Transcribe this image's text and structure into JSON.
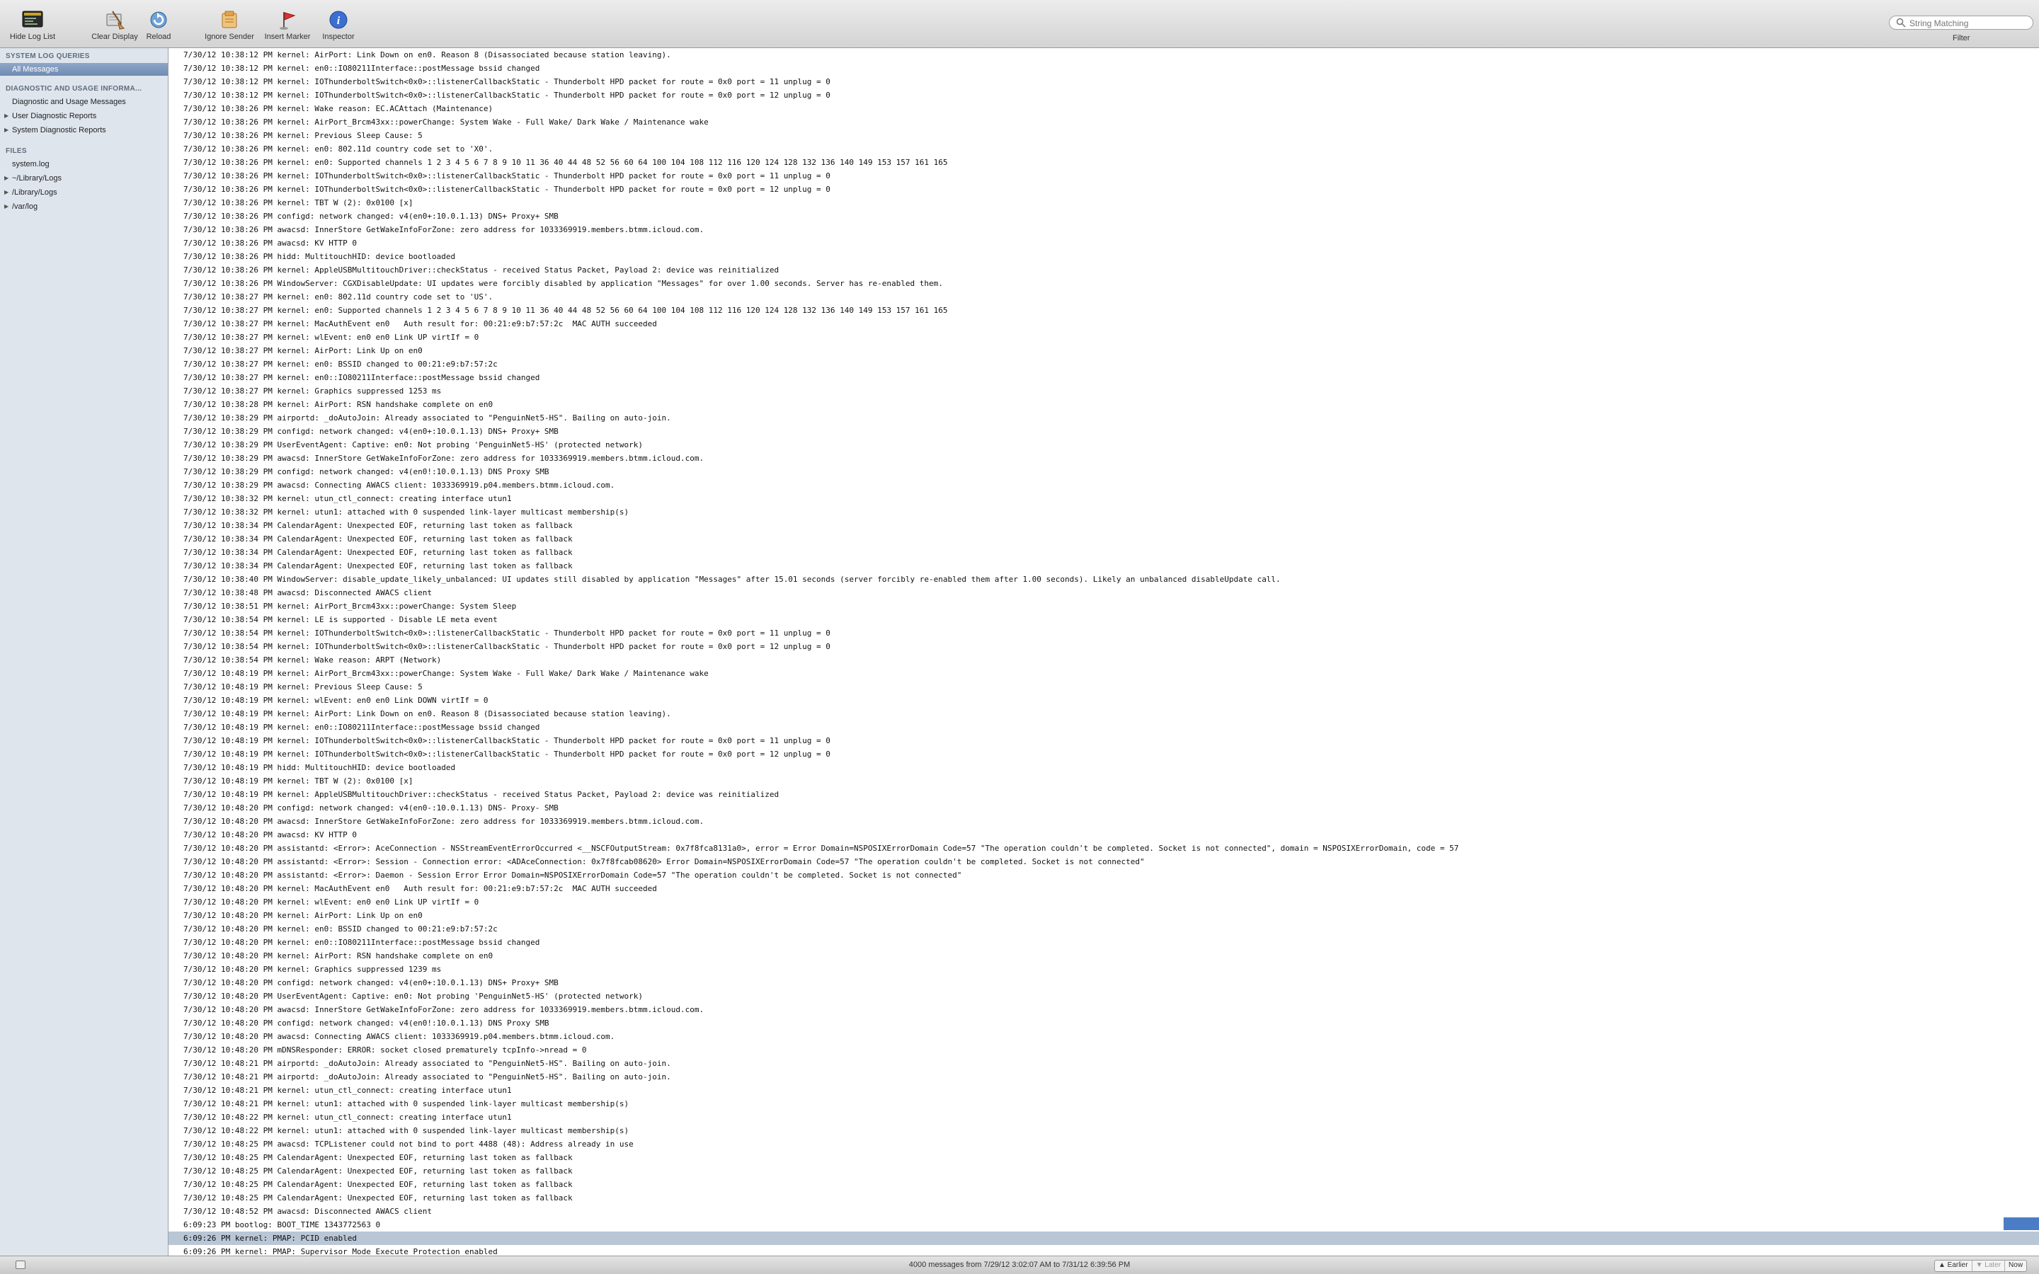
{
  "toolbar": {
    "hide_log_list": "Hide Log List",
    "clear_display": "Clear Display",
    "reload": "Reload",
    "ignore_sender": "Ignore Sender",
    "insert_marker": "Insert Marker",
    "inspector": "Inspector",
    "search_placeholder": "String Matching",
    "filter": "Filter"
  },
  "sidebar": {
    "section_system_log_queries": "SYSTEM LOG QUERIES",
    "all_messages": "All Messages",
    "section_diagnostic": "DIAGNOSTIC AND USAGE INFORMA...",
    "diag_usage_messages": "Diagnostic and Usage Messages",
    "user_diag_reports": "User Diagnostic Reports",
    "system_diag_reports": "System Diagnostic Reports",
    "section_files": "FILES",
    "system_log": "system.log",
    "user_library_logs": "~/Library/Logs",
    "library_logs": "/Library/Logs",
    "var_log": "/var/log"
  },
  "log_lines": [
    "7/30/12 10:38:12 PM kernel: AirPort: Link Down on en0. Reason 8 (Disassociated because station leaving).",
    "7/30/12 10:38:12 PM kernel: en0::IO80211Interface::postMessage bssid changed",
    "7/30/12 10:38:12 PM kernel: IOThunderboltSwitch<0x0>::listenerCallbackStatic - Thunderbolt HPD packet for route = 0x0 port = 11 unplug = 0",
    "7/30/12 10:38:12 PM kernel: IOThunderboltSwitch<0x0>::listenerCallbackStatic - Thunderbolt HPD packet for route = 0x0 port = 12 unplug = 0",
    "7/30/12 10:38:26 PM kernel: Wake reason: EC.ACAttach (Maintenance)",
    "7/30/12 10:38:26 PM kernel: AirPort_Brcm43xx::powerChange: System Wake - Full Wake/ Dark Wake / Maintenance wake",
    "7/30/12 10:38:26 PM kernel: Previous Sleep Cause: 5",
    "7/30/12 10:38:26 PM kernel: en0: 802.11d country code set to 'X0'.",
    "7/30/12 10:38:26 PM kernel: en0: Supported channels 1 2 3 4 5 6 7 8 9 10 11 36 40 44 48 52 56 60 64 100 104 108 112 116 120 124 128 132 136 140 149 153 157 161 165",
    "7/30/12 10:38:26 PM kernel: IOThunderboltSwitch<0x0>::listenerCallbackStatic - Thunderbolt HPD packet for route = 0x0 port = 11 unplug = 0",
    "7/30/12 10:38:26 PM kernel: IOThunderboltSwitch<0x0>::listenerCallbackStatic - Thunderbolt HPD packet for route = 0x0 port = 12 unplug = 0",
    "7/30/12 10:38:26 PM kernel: TBT W (2): 0x0100 [x]",
    "7/30/12 10:38:26 PM configd: network changed: v4(en0+:10.0.1.13) DNS+ Proxy+ SMB",
    "7/30/12 10:38:26 PM awacsd: InnerStore GetWakeInfoForZone: zero address for 1033369919.members.btmm.icloud.com.",
    "7/30/12 10:38:26 PM awacsd: KV HTTP 0",
    "7/30/12 10:38:26 PM hidd: MultitouchHID: device bootloaded",
    "7/30/12 10:38:26 PM kernel: AppleUSBMultitouchDriver::checkStatus - received Status Packet, Payload 2: device was reinitialized",
    "7/30/12 10:38:26 PM WindowServer: CGXDisableUpdate: UI updates were forcibly disabled by application \"Messages\" for over 1.00 seconds. Server has re-enabled them.",
    "7/30/12 10:38:27 PM kernel: en0: 802.11d country code set to 'US'.",
    "7/30/12 10:38:27 PM kernel: en0: Supported channels 1 2 3 4 5 6 7 8 9 10 11 36 40 44 48 52 56 60 64 100 104 108 112 116 120 124 128 132 136 140 149 153 157 161 165",
    "7/30/12 10:38:27 PM kernel: MacAuthEvent en0   Auth result for: 00:21:e9:b7:57:2c  MAC AUTH succeeded",
    "7/30/12 10:38:27 PM kernel: wlEvent: en0 en0 Link UP virtIf = 0",
    "7/30/12 10:38:27 PM kernel: AirPort: Link Up on en0",
    "7/30/12 10:38:27 PM kernel: en0: BSSID changed to 00:21:e9:b7:57:2c",
    "7/30/12 10:38:27 PM kernel: en0::IO80211Interface::postMessage bssid changed",
    "7/30/12 10:38:27 PM kernel: Graphics suppressed 1253 ms",
    "7/30/12 10:38:28 PM kernel: AirPort: RSN handshake complete on en0",
    "7/30/12 10:38:29 PM airportd: _doAutoJoin: Already associated to \"PenguinNet5-HS\". Bailing on auto-join.",
    "7/30/12 10:38:29 PM configd: network changed: v4(en0+:10.0.1.13) DNS+ Proxy+ SMB",
    "7/30/12 10:38:29 PM UserEventAgent: Captive: en0: Not probing 'PenguinNet5-HS' (protected network)",
    "7/30/12 10:38:29 PM awacsd: InnerStore GetWakeInfoForZone: zero address for 1033369919.members.btmm.icloud.com.",
    "7/30/12 10:38:29 PM configd: network changed: v4(en0!:10.0.1.13) DNS Proxy SMB",
    "7/30/12 10:38:29 PM awacsd: Connecting AWACS client: 1033369919.p04.members.btmm.icloud.com.",
    "7/30/12 10:38:32 PM kernel: utun_ctl_connect: creating interface utun1",
    "7/30/12 10:38:32 PM kernel: utun1: attached with 0 suspended link-layer multicast membership(s)",
    "7/30/12 10:38:34 PM CalendarAgent: Unexpected EOF, returning last token as fallback",
    "7/30/12 10:38:34 PM CalendarAgent: Unexpected EOF, returning last token as fallback",
    "7/30/12 10:38:34 PM CalendarAgent: Unexpected EOF, returning last token as fallback",
    "7/30/12 10:38:34 PM CalendarAgent: Unexpected EOF, returning last token as fallback",
    "7/30/12 10:38:40 PM WindowServer: disable_update_likely_unbalanced: UI updates still disabled by application \"Messages\" after 15.01 seconds (server forcibly re-enabled them after 1.00 seconds). Likely an unbalanced disableUpdate call.",
    "7/30/12 10:38:48 PM awacsd: Disconnected AWACS client",
    "7/30/12 10:38:51 PM kernel: AirPort_Brcm43xx::powerChange: System Sleep",
    "7/30/12 10:38:54 PM kernel: LE is supported - Disable LE meta event",
    "7/30/12 10:38:54 PM kernel: IOThunderboltSwitch<0x0>::listenerCallbackStatic - Thunderbolt HPD packet for route = 0x0 port = 11 unplug = 0",
    "7/30/12 10:38:54 PM kernel: IOThunderboltSwitch<0x0>::listenerCallbackStatic - Thunderbolt HPD packet for route = 0x0 port = 12 unplug = 0",
    "7/30/12 10:38:54 PM kernel: Wake reason: ARPT (Network)",
    "7/30/12 10:48:19 PM kernel: AirPort_Brcm43xx::powerChange: System Wake - Full Wake/ Dark Wake / Maintenance wake",
    "7/30/12 10:48:19 PM kernel: Previous Sleep Cause: 5",
    "7/30/12 10:48:19 PM kernel: wlEvent: en0 en0 Link DOWN virtIf = 0",
    "7/30/12 10:48:19 PM kernel: AirPort: Link Down on en0. Reason 8 (Disassociated because station leaving).",
    "7/30/12 10:48:19 PM kernel: en0::IO80211Interface::postMessage bssid changed",
    "7/30/12 10:48:19 PM kernel: IOThunderboltSwitch<0x0>::listenerCallbackStatic - Thunderbolt HPD packet for route = 0x0 port = 11 unplug = 0",
    "7/30/12 10:48:19 PM kernel: IOThunderboltSwitch<0x0>::listenerCallbackStatic - Thunderbolt HPD packet for route = 0x0 port = 12 unplug = 0",
    "7/30/12 10:48:19 PM hidd: MultitouchHID: device bootloaded",
    "7/30/12 10:48:19 PM kernel: TBT W (2): 0x0100 [x]",
    "7/30/12 10:48:19 PM kernel: AppleUSBMultitouchDriver::checkStatus - received Status Packet, Payload 2: device was reinitialized",
    "7/30/12 10:48:20 PM configd: network changed: v4(en0-:10.0.1.13) DNS- Proxy- SMB",
    "7/30/12 10:48:20 PM awacsd: InnerStore GetWakeInfoForZone: zero address for 1033369919.members.btmm.icloud.com.",
    "7/30/12 10:48:20 PM awacsd: KV HTTP 0",
    "7/30/12 10:48:20 PM assistantd: <Error>: AceConnection - NSStreamEventErrorOccurred <__NSCFOutputStream: 0x7f8fca8131a0>, error = Error Domain=NSPOSIXErrorDomain Code=57 \"The operation couldn't be completed. Socket is not connected\", domain = NSPOSIXErrorDomain, code = 57",
    "7/30/12 10:48:20 PM assistantd: <Error>: Session - Connection error: <ADAceConnection: 0x7f8fcab08620> Error Domain=NSPOSIXErrorDomain Code=57 \"The operation couldn't be completed. Socket is not connected\"",
    "7/30/12 10:48:20 PM assistantd: <Error>: Daemon - Session Error Error Domain=NSPOSIXErrorDomain Code=57 \"The operation couldn't be completed. Socket is not connected\"",
    "7/30/12 10:48:20 PM kernel: MacAuthEvent en0   Auth result for: 00:21:e9:b7:57:2c  MAC AUTH succeeded",
    "7/30/12 10:48:20 PM kernel: wlEvent: en0 en0 Link UP virtIf = 0",
    "7/30/12 10:48:20 PM kernel: AirPort: Link Up on en0",
    "7/30/12 10:48:20 PM kernel: en0: BSSID changed to 00:21:e9:b7:57:2c",
    "7/30/12 10:48:20 PM kernel: en0::IO80211Interface::postMessage bssid changed",
    "7/30/12 10:48:20 PM kernel: AirPort: RSN handshake complete on en0",
    "7/30/12 10:48:20 PM kernel: Graphics suppressed 1239 ms",
    "7/30/12 10:48:20 PM configd: network changed: v4(en0+:10.0.1.13) DNS+ Proxy+ SMB",
    "7/30/12 10:48:20 PM UserEventAgent: Captive: en0: Not probing 'PenguinNet5-HS' (protected network)",
    "7/30/12 10:48:20 PM awacsd: InnerStore GetWakeInfoForZone: zero address for 1033369919.members.btmm.icloud.com.",
    "7/30/12 10:48:20 PM configd: network changed: v4(en0!:10.0.1.13) DNS Proxy SMB",
    "7/30/12 10:48:20 PM awacsd: Connecting AWACS client: 1033369919.p04.members.btmm.icloud.com.",
    "7/30/12 10:48:20 PM mDNSResponder: ERROR: socket closed prematurely tcpInfo->nread = 0",
    "7/30/12 10:48:21 PM airportd: _doAutoJoin: Already associated to \"PenguinNet5-HS\". Bailing on auto-join.",
    "7/30/12 10:48:21 PM airportd: _doAutoJoin: Already associated to \"PenguinNet5-HS\". Bailing on auto-join.",
    "7/30/12 10:48:21 PM kernel: utun_ctl_connect: creating interface utun1",
    "7/30/12 10:48:21 PM kernel: utun1: attached with 0 suspended link-layer multicast membership(s)",
    "7/30/12 10:48:22 PM kernel: utun_ctl_connect: creating interface utun1",
    "7/30/12 10:48:22 PM kernel: utun1: attached with 0 suspended link-layer multicast membership(s)",
    "7/30/12 10:48:25 PM awacsd: TCPListener could not bind to port 4488 (48): Address already in use",
    "7/30/12 10:48:25 PM CalendarAgent: Unexpected EOF, returning last token as fallback",
    "7/30/12 10:48:25 PM CalendarAgent: Unexpected EOF, returning last token as fallback",
    "7/30/12 10:48:25 PM CalendarAgent: Unexpected EOF, returning last token as fallback",
    "7/30/12 10:48:25 PM CalendarAgent: Unexpected EOF, returning last token as fallback",
    "7/30/12 10:48:52 PM awacsd: Disconnected AWACS client",
    "6:09:23 PM bootlog: BOOT_TIME 1343772563 0",
    "6:09:26 PM kernel: PMAP: PCID enabled",
    "6:09:26 PM kernel: PMAP: Supervisor Mode Execute Protection enabled"
  ],
  "boot_line_index": 88,
  "status": {
    "summary": "4000 messages from 7/29/12 3:02:07 AM to 7/31/12 6:39:56 PM",
    "earlier": "▲ Earlier",
    "later": "▼ Later",
    "now": "Now"
  },
  "colors": {
    "sidebar_bg": "#dfe5ed",
    "selection": "#6e8bb3",
    "boot_row": "#b9c6d6",
    "inspector_blue": "#3c6fd1"
  }
}
